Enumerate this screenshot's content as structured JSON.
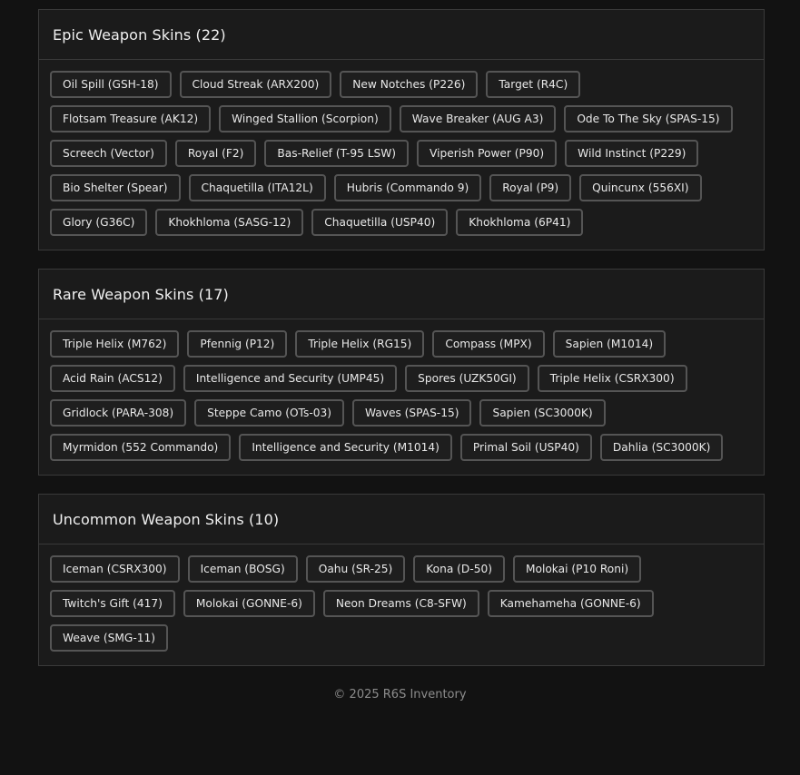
{
  "sections": [
    {
      "title": "Epic Weapon Skins (22)",
      "items": [
        "Oil Spill (GSH-18)",
        "Cloud Streak (ARX200)",
        "New Notches (P226)",
        "Target (R4C)",
        "Flotsam Treasure (AK12)",
        "Winged Stallion (Scorpion)",
        "Wave Breaker (AUG A3)",
        "Ode To The Sky (SPAS-15)",
        "Screech (Vector)",
        "Royal (F2)",
        "Bas-Relief (T-95 LSW)",
        "Viperish Power (P90)",
        "Wild Instinct (P229)",
        "Bio Shelter (Spear)",
        "Chaquetilla (ITA12L)",
        "Hubris (Commando 9)",
        "Royal (P9)",
        "Quincunx (556XI)",
        "Glory (G36C)",
        "Khokhloma (SASG-12)",
        "Chaquetilla (USP40)",
        "Khokhloma (6P41)"
      ]
    },
    {
      "title": "Rare Weapon Skins (17)",
      "items": [
        "Triple Helix (M762)",
        "Pfennig (P12)",
        "Triple Helix (RG15)",
        "Compass (MPX)",
        "Sapien (M1014)",
        "Acid Rain (ACS12)",
        "Intelligence and Security (UMP45)",
        "Spores (UZK50GI)",
        "Triple Helix (CSRX300)",
        "Gridlock (PARA-308)",
        "Steppe Camo (OTs-03)",
        "Waves (SPAS-15)",
        "Sapien (SC3000K)",
        "Myrmidon (552 Commando)",
        "Intelligence and Security (M1014)",
        "Primal Soil (USP40)",
        "Dahlia (SC3000K)"
      ]
    },
    {
      "title": "Uncommon Weapon Skins (10)",
      "items": [
        "Iceman (CSRX300)",
        "Iceman (BOSG)",
        "Oahu (SR-25)",
        "Kona (D-50)",
        "Molokai (P10 Roni)",
        "Twitch's Gift (417)",
        "Molokai (GONNE-6)",
        "Neon Dreams (C8-SFW)",
        "Kamehameha (GONNE-6)",
        "Weave (SMG-11)"
      ]
    }
  ],
  "footer": "© 2025 R6S Inventory"
}
